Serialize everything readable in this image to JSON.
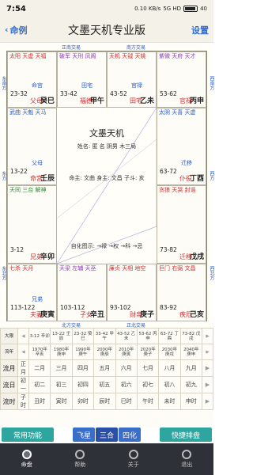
{
  "status": {
    "time": "7:54",
    "net": "0.10 KB/s",
    "sig": "5G HD",
    "battery": "40"
  },
  "header": {
    "back_label": "命例",
    "title": "文墨天机专业版",
    "settings_label": "设置"
  },
  "chart_labels": {
    "top_left": "正南交易",
    "top_right": "南方交易",
    "bottom_left": "北方交易",
    "bottom_right": "正北交易",
    "left_top": "东南方",
    "left_mid": "东方",
    "left_bot": "东北方",
    "right_top": "西南方",
    "right_mid": "西方",
    "right_bot": "西北方"
  },
  "palaces": [
    {
      "name": "父母",
      "gz": "癸巳",
      "ages": "23-32",
      "mid": "命宫",
      "stars": "太阳 天虚 天福"
    },
    {
      "name": "福德",
      "gz": "甲午",
      "ages": "33-42",
      "mid": "田宅",
      "stars": "破军 天刑 凤阁"
    },
    {
      "name": "田宅",
      "gz": "乙未",
      "ages": "43-52",
      "mid": "官禄",
      "stars": "天机 天钺 天姚"
    },
    {
      "name": "官禄",
      "gz": "丙申",
      "ages": "53-62",
      "mid": "",
      "stars": "紫微 天府 天才"
    },
    {
      "name": "命宫",
      "gz": "壬辰",
      "ages": "13-22",
      "mid": "父母",
      "stars": "武曲 天魁 天马"
    },
    {
      "name": "仆役",
      "gz": "丁酉",
      "ages": "63-72",
      "mid": "迁移",
      "stars": "太阴 天喜 天虚"
    },
    {
      "name": "兄弟",
      "gz": "辛卯",
      "ages": "3-12",
      "mid": "",
      "stars": "天同 三台 解神"
    },
    {
      "name": "迁移",
      "gz": "戊戌",
      "ages": "73-82",
      "mid": "",
      "stars": "贪狼 天哭 封诰"
    },
    {
      "name": "夫妻",
      "gz": "庚寅",
      "ages": "113-122",
      "mid": "兄弟",
      "stars": "七杀 天月"
    },
    {
      "name": "子女",
      "gz": "辛丑",
      "ages": "103-112",
      "mid": "",
      "stars": "天梁 左辅 天巫"
    },
    {
      "name": "财帛",
      "gz": "庚子",
      "ages": "93-102",
      "mid": "",
      "stars": "廉贞 天相 地空"
    },
    {
      "name": "疾厄",
      "gz": "己亥",
      "ages": "83-92",
      "mid": "",
      "stars": "巨门 右弼 文昌"
    }
  ],
  "center": {
    "title": "文墨天机",
    "line1": "姓名: 匿 名    阴男 木三局",
    "line2": "命主: 文曲  身主: 文昌  子斗: 亥",
    "line3": "自化图示: →禄 →权 →科 →忌"
  },
  "grid": {
    "rows": [
      {
        "label": "大限",
        "cells": [
          "3-12 辛卯",
          "13-22 壬辰",
          "23-32 癸巳",
          "33-42 甲午",
          "43-52 乙未",
          "53-62 丙申",
          "63-72 丁酉",
          "73-82 戊戌"
        ]
      },
      {
        "label": "流年",
        "cells": [
          "1970年 辛亥",
          "1980年 庚申",
          "1990年 庚午",
          "2000年 庚辰",
          "2010年 庚寅",
          "2020年 庚子",
          "2030年 庚戌",
          "2040年 庚申"
        ]
      },
      {
        "label": "流月",
        "cells": [
          "正月",
          "二月",
          "三月",
          "四月",
          "五月",
          "六月",
          "七月",
          "八月",
          "九月"
        ]
      },
      {
        "label": "流日",
        "cells": [
          "初一",
          "初二",
          "初三",
          "初四",
          "初五",
          "初六",
          "初七",
          "初八",
          "初九"
        ]
      },
      {
        "label": "流时",
        "cells": [
          "子时",
          "丑时",
          "寅时",
          "卯时",
          "辰时",
          "巳时",
          "午时",
          "未时",
          "申时"
        ]
      }
    ]
  },
  "toolbar": {
    "left": "常用功能",
    "mid1": "飞星",
    "mid2": "三合",
    "mid3": "四化",
    "right": "快捷排盘"
  },
  "tabs": [
    "命盘",
    "帮助",
    "关于",
    "退出"
  ],
  "colors": {
    "accent": "#3a6fc9",
    "red": "#d42b2b",
    "teal": "#2fa5a0",
    "dark": "#2e3138"
  }
}
